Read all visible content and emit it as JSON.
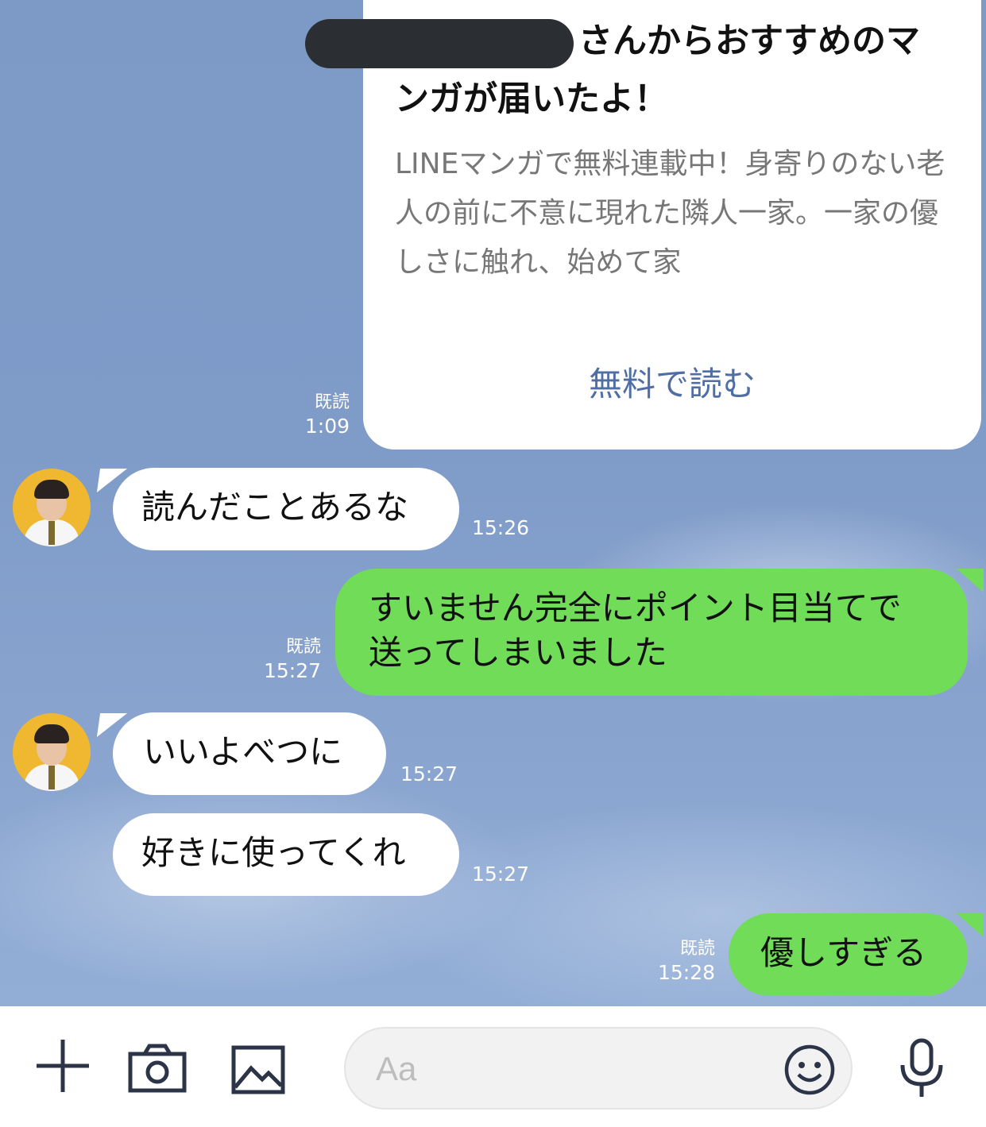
{
  "card": {
    "title_suffix": "さんからおすすめのマンガが届いたよ！",
    "description": "LINEマンガで無料連載中！身寄りのない老人の前に不意に現れた隣人一家。一家の優しさに触れ、始めて家",
    "link_label": "無料で読む",
    "read_label": "既読",
    "time": "1:09"
  },
  "messages": [
    {
      "side": "left",
      "text": "読んだことあるな",
      "time": "15:26"
    },
    {
      "side": "right",
      "text_line1": "すいません完全にポイント目当てで",
      "text_line2": "送ってしまいました",
      "read": "既読",
      "time": "15:27"
    },
    {
      "side": "left",
      "text": "いいよべつに",
      "time": "15:27"
    },
    {
      "side": "left",
      "text": "好きに使ってくれ",
      "time": "15:27"
    },
    {
      "side": "right",
      "text": "優しすぎる",
      "read": "既読",
      "time": "15:28"
    }
  ],
  "input": {
    "placeholder": "Aa"
  },
  "icons": [
    "plus-icon",
    "camera-icon",
    "image-icon",
    "emoji-icon",
    "microphone-icon"
  ],
  "colors": {
    "background": "#7f9bc8",
    "sent_bubble": "#71dc57",
    "received_bubble": "#ffffff",
    "link": "#4f6ea4"
  }
}
